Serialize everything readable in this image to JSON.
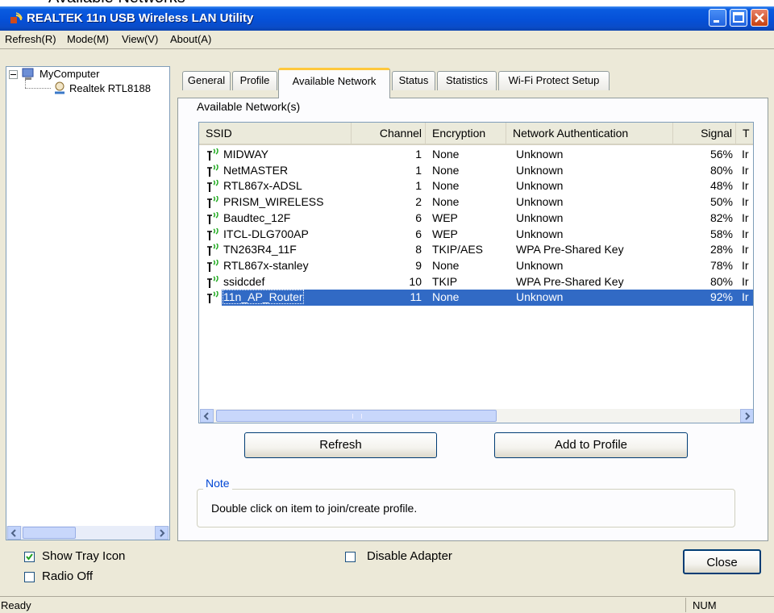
{
  "window": {
    "title": "REALTEK 11n USB Wireless LAN Utility",
    "partial_top_text": "Available Networks"
  },
  "menu": [
    "Refresh(R)",
    "Mode(M)",
    "View(V)",
    "About(A)"
  ],
  "tree": {
    "root": "MyComputer",
    "child": "Realtek RTL8188"
  },
  "tabs": [
    "General",
    "Profile",
    "Available Network",
    "Status",
    "Statistics",
    "Wi-Fi Protect Setup"
  ],
  "active_tab": "Available Network",
  "list": {
    "group_label": "Available Network(s)",
    "columns": [
      "SSID",
      "Channel",
      "Encryption",
      "Network Authentication",
      "Signal",
      "T"
    ],
    "rows": [
      {
        "ssid": "MIDWAY",
        "channel": "1",
        "encryption": "None",
        "auth": "Unknown",
        "signal": "56%",
        "type": "Ir"
      },
      {
        "ssid": "NetMASTER",
        "channel": "1",
        "encryption": "None",
        "auth": "Unknown",
        "signal": "80%",
        "type": "Ir"
      },
      {
        "ssid": "RTL867x-ADSL",
        "channel": "1",
        "encryption": "None",
        "auth": "Unknown",
        "signal": "48%",
        "type": "Ir"
      },
      {
        "ssid": "PRISM_WIRELESS",
        "channel": "2",
        "encryption": "None",
        "auth": "Unknown",
        "signal": "50%",
        "type": "Ir"
      },
      {
        "ssid": "Baudtec_12F",
        "channel": "6",
        "encryption": "WEP",
        "auth": "Unknown",
        "signal": "82%",
        "type": "Ir"
      },
      {
        "ssid": "ITCL-DLG700AP",
        "channel": "6",
        "encryption": "WEP",
        "auth": "Unknown",
        "signal": "58%",
        "type": "Ir"
      },
      {
        "ssid": "TN263R4_11F",
        "channel": "8",
        "encryption": "TKIP/AES",
        "auth": "WPA Pre-Shared Key",
        "signal": "28%",
        "type": "Ir"
      },
      {
        "ssid": "RTL867x-stanley",
        "channel": "9",
        "encryption": "None",
        "auth": "Unknown",
        "signal": "78%",
        "type": "Ir"
      },
      {
        "ssid": "ssidcdef",
        "channel": "10",
        "encryption": "TKIP",
        "auth": "WPA Pre-Shared Key",
        "signal": "80%",
        "type": "Ir"
      },
      {
        "ssid": "11n_AP_Router",
        "channel": "11",
        "encryption": "None",
        "auth": "Unknown",
        "signal": "92%",
        "type": "Ir",
        "selected": true
      }
    ]
  },
  "buttons": {
    "refresh": "Refresh",
    "add_profile": "Add to Profile",
    "close": "Close"
  },
  "note": {
    "legend": "Note",
    "text": "Double click on item to join/create profile."
  },
  "options": {
    "show_tray_icon": {
      "label": "Show Tray Icon",
      "checked": true
    },
    "radio_off": {
      "label": "Radio Off",
      "checked": false
    },
    "disable_adapter": {
      "label": "Disable Adapter",
      "checked": false
    }
  },
  "status": {
    "left": "Ready",
    "right": "NUM"
  },
  "colors": {
    "title_blue": "#0550d8",
    "selection": "#316ac5",
    "note_blue": "#0046d5",
    "signal_green": "#22aa22"
  },
  "icons": [
    "wifi-utility-icon",
    "minimize-icon",
    "maximize-icon",
    "close-icon",
    "computer-icon",
    "network-adapter-icon",
    "signal-icon",
    "scroll-left-icon",
    "scroll-right-icon",
    "checkmark-icon"
  ]
}
